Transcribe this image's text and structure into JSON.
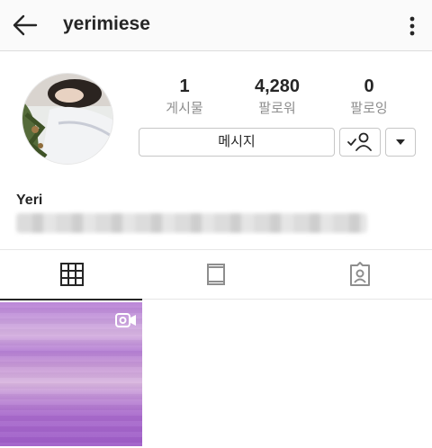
{
  "header": {
    "username": "yerimiese",
    "back_icon": "arrow-left-icon",
    "menu_icon": "more-vertical-icon"
  },
  "profile": {
    "stats": [
      {
        "value": "1",
        "label": "게시물"
      },
      {
        "value": "4,280",
        "label": "팔로워"
      },
      {
        "value": "0",
        "label": "팔로잉"
      }
    ],
    "message_button": "메시지",
    "follow_icon": "following-check-icon",
    "dropdown_icon": "caret-down-icon",
    "display_name": "Yeri"
  },
  "tabs": [
    {
      "name": "grid",
      "icon": "grid-icon",
      "active": true
    },
    {
      "name": "feed",
      "icon": "feed-icon",
      "active": false
    },
    {
      "name": "tagged",
      "icon": "tagged-icon",
      "active": false
    }
  ],
  "posts": [
    {
      "type": "video",
      "icon": "video-icon"
    }
  ],
  "colors": {
    "text": "#262626",
    "muted": "#8e8e8e",
    "border": "#c7c7c7"
  }
}
